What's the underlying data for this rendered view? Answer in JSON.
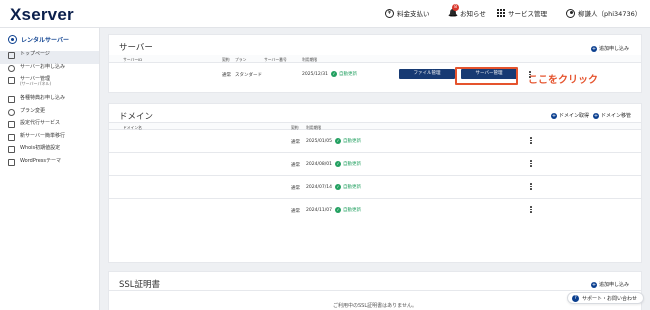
{
  "header": {
    "logo": "Xserver",
    "nav": [
      {
        "label": "料金支払い",
        "icon": "yen-circle-icon"
      },
      {
        "label": "お知らせ",
        "icon": "bell-icon",
        "badge": "8"
      },
      {
        "label": "サービス管理",
        "icon": "grid-icon"
      },
      {
        "label": "柳謙人（phi34736）",
        "icon": "user-icon"
      }
    ]
  },
  "sidebar": {
    "title": "レンタルサーバー",
    "items": [
      {
        "label": "トップページ",
        "icon": "home-icon",
        "active": true
      },
      {
        "label": "サーバーお申し込み",
        "icon": "plus-circle-icon"
      },
      {
        "label": "サーバー管理",
        "sub": "(サーバーパネル)",
        "icon": "server-icon"
      },
      {
        "label": "各種特典お申し込み",
        "icon": "gift-icon"
      },
      {
        "label": "プラン変更",
        "icon": "refresh-icon"
      },
      {
        "label": "設定代行サービス",
        "icon": "tools-icon"
      },
      {
        "label": "新サーバー簡単移行",
        "icon": "transfer-icon"
      },
      {
        "label": "Whois初期値設定",
        "icon": "document-icon"
      },
      {
        "label": "WordPressテーマ",
        "icon": "wordpress-icon"
      }
    ]
  },
  "server_section": {
    "title": "サーバー",
    "add_link": "追加申し込み",
    "headers": {
      "id": "サーバーID",
      "status": "契約",
      "plan": "プラン",
      "server_no": "サーバー番号",
      "expiry": "利用期限"
    },
    "row": {
      "status": "通常",
      "plan": "スタンダード",
      "expiry": "2025/12/31",
      "renew": "自動更新",
      "file_button": "ファイル管理",
      "server_button": "サーバー管理"
    },
    "callout": "ここをクリック"
  },
  "domain_section": {
    "title": "ドメイン",
    "manage_link": "ドメイン取得",
    "transfer_link": "ドメイン移管",
    "headers": {
      "name": "ドメイン名",
      "status": "契約",
      "expiry": "利用期限"
    },
    "rows": [
      {
        "status": "通常",
        "expiry": "2025/01/05",
        "renew": "自動更新"
      },
      {
        "status": "通常",
        "expiry": "2024/08/01",
        "renew": "自動更新"
      },
      {
        "status": "通常",
        "expiry": "2024/07/14",
        "renew": "自動更新"
      },
      {
        "status": "通常",
        "expiry": "2024/11/07",
        "renew": "自動更新"
      }
    ]
  },
  "ssl_section": {
    "title": "SSL証明書",
    "add_link": "追加申し込み",
    "empty": "ご利用中のSSL証明書はありません。"
  },
  "support": {
    "label": "サポート・お問い合わせ"
  },
  "colors": {
    "navy": "#173a73",
    "accent": "#e5532d",
    "ok": "#22a060",
    "link": "#0b3f8f"
  }
}
